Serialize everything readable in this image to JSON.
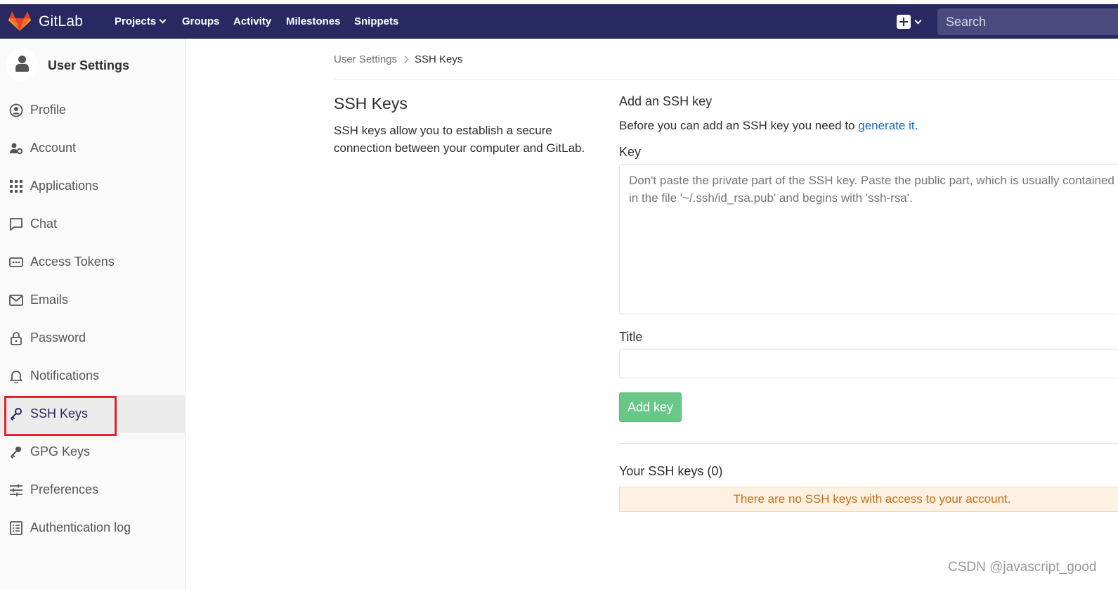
{
  "navbar": {
    "brand": "GitLab",
    "items": [
      {
        "label": "Projects",
        "has_dropdown": true
      },
      {
        "label": "Groups"
      },
      {
        "label": "Activity"
      },
      {
        "label": "Milestones"
      },
      {
        "label": "Snippets"
      }
    ],
    "search_placeholder": "Search",
    "colors": {
      "bg": "#292961",
      "logo": "#e24329"
    }
  },
  "sidebar": {
    "title": "User Settings",
    "items": [
      {
        "label": "Profile",
        "icon": "profile-icon"
      },
      {
        "label": "Account",
        "icon": "account-icon"
      },
      {
        "label": "Applications",
        "icon": "applications-icon"
      },
      {
        "label": "Chat",
        "icon": "chat-icon"
      },
      {
        "label": "Access Tokens",
        "icon": "token-icon"
      },
      {
        "label": "Emails",
        "icon": "email-icon"
      },
      {
        "label": "Password",
        "icon": "lock-icon"
      },
      {
        "label": "Notifications",
        "icon": "bell-icon"
      },
      {
        "label": "SSH Keys",
        "icon": "key-icon",
        "active": true
      },
      {
        "label": "GPG Keys",
        "icon": "key-icon"
      },
      {
        "label": "Preferences",
        "icon": "sliders-icon"
      },
      {
        "label": "Authentication log",
        "icon": "log-icon"
      }
    ]
  },
  "breadcrumb": {
    "parent": "User Settings",
    "current": "SSH Keys"
  },
  "left": {
    "title": "SSH Keys",
    "description": "SSH keys allow you to establish a secure connection between your computer and GitLab."
  },
  "form": {
    "heading": "Add an SSH key",
    "intro_text": "Before you can add an SSH key you need to ",
    "intro_link": "generate it.",
    "key_label": "Key",
    "key_placeholder": "Don't paste the private part of the SSH key. Paste the public part, which is usually contained in the file '~/.ssh/id_rsa.pub' and begins with 'ssh-rsa'.",
    "title_label": "Title",
    "title_value": "",
    "submit_label": "Add key"
  },
  "keys_list": {
    "heading": "Your SSH keys (0)",
    "empty_message": "There are no SSH keys with access to your account."
  },
  "watermark": "CSDN @javascript_good"
}
